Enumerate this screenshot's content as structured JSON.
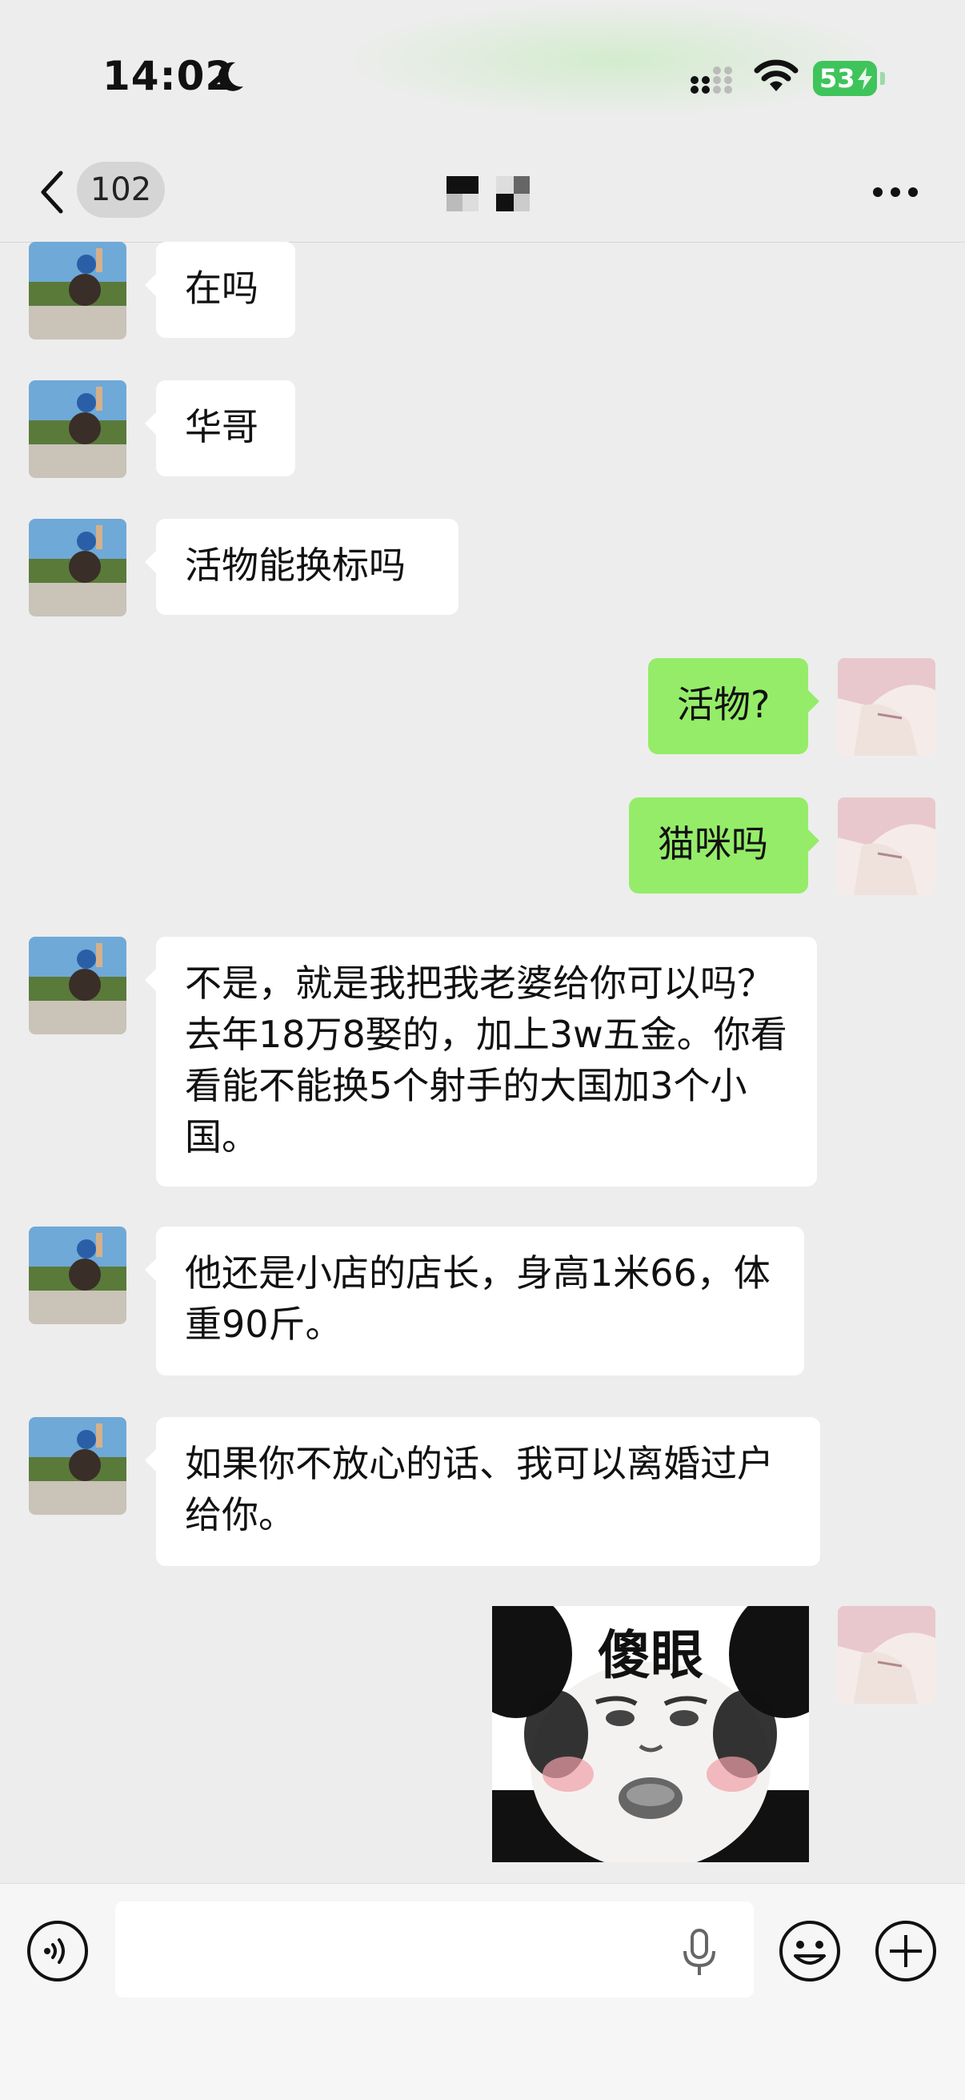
{
  "status_bar": {
    "time": "14:02",
    "battery": "53"
  },
  "nav": {
    "unread_count": "102"
  },
  "messages": [
    {
      "side": "left",
      "text": "在吗"
    },
    {
      "side": "left",
      "text": "华哥"
    },
    {
      "side": "left",
      "text": "活物能换标吗"
    },
    {
      "side": "right",
      "text": "活物?"
    },
    {
      "side": "right",
      "text": "猫咪吗"
    },
    {
      "side": "left",
      "text": "不是，就是我把我老婆给你可以吗？去年18万8娶的，加上3w五金。你看看能不能换5个射手的大国加3个小国。"
    },
    {
      "side": "left",
      "text": "他还是小店的店长，身高1米66，体重90斤。"
    },
    {
      "side": "left",
      "text": "如果你不放心的话、我可以离婚过户给你。"
    }
  ],
  "sticker": {
    "caption": "傻眼"
  },
  "input": {
    "placeholder": ""
  },
  "colors": {
    "accent_green": "#95ec69",
    "background": "#ededed"
  }
}
